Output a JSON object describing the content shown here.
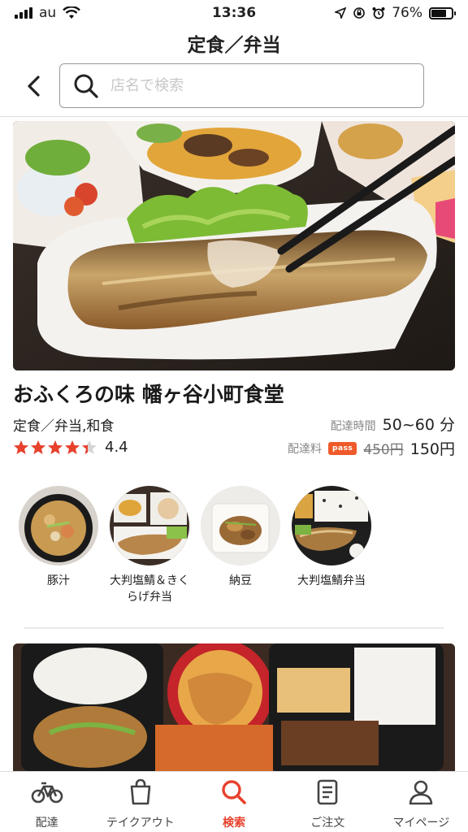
{
  "status": {
    "carrier": "au",
    "time": "13:36",
    "battery": "76%",
    "battery_level": 0.76
  },
  "nav": {
    "title": "定食／弁当"
  },
  "search": {
    "placeholder": "店名で検索"
  },
  "restaurant": {
    "name": "おふくろの味 幡ヶ谷小町食堂",
    "categories": "定食／弁当,和食",
    "rating": 4.4,
    "rating_text": "4.4",
    "delivery_time_label": "配達時間",
    "delivery_time": "50~60 分",
    "fee_label": "配達料",
    "pass_badge": "pass",
    "fee_old": "450円",
    "fee_new": "150円"
  },
  "dishes": [
    {
      "name": "豚汁"
    },
    {
      "name": "大判塩鯖＆きくらげ弁当"
    },
    {
      "name": "納豆"
    },
    {
      "name": "大判塩鯖弁当"
    }
  ],
  "tabs": [
    {
      "label": "配達",
      "icon": "bicycle-icon"
    },
    {
      "label": "テイクアウト",
      "icon": "bag-icon"
    },
    {
      "label": "検索",
      "icon": "search-icon",
      "active": true
    },
    {
      "label": "ご注文",
      "icon": "receipt-icon"
    },
    {
      "label": "マイページ",
      "icon": "person-icon"
    }
  ],
  "colors": {
    "accent": "#e8412c",
    "star": "#e8412c",
    "pass": "#ef5a2a"
  }
}
